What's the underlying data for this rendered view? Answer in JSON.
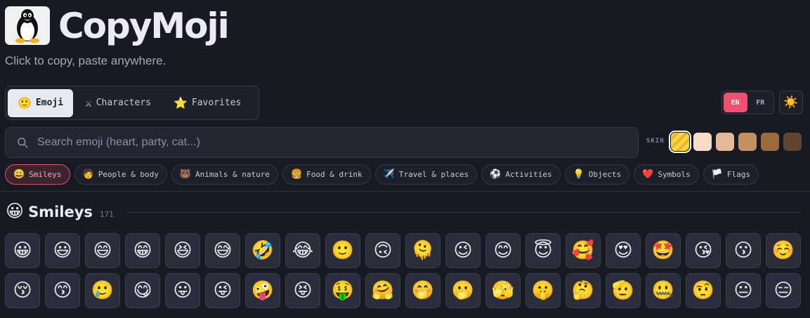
{
  "app": {
    "title": "CopyMoji",
    "tagline": "Click to copy, paste anywhere.",
    "logo_icon": "penguin-icon"
  },
  "tabs": [
    {
      "icon": "🙂",
      "label": "Emoji",
      "active": true
    },
    {
      "icon": "⚔",
      "label": "Characters",
      "active": false
    },
    {
      "icon": "⭐",
      "label": "Favorites",
      "active": false
    }
  ],
  "language": {
    "options": [
      "EN",
      "FR"
    ],
    "selected": "EN"
  },
  "theme_icon": "☀️",
  "search": {
    "placeholder": "Search emoji (heart, party, cat...)",
    "value": ""
  },
  "skin": {
    "label": "SKIN",
    "tones": [
      "default",
      "#f8dbc9",
      "#e4b999",
      "#c48e63",
      "#9b6a40",
      "#5f4632"
    ],
    "selected": "default"
  },
  "categories": [
    {
      "icon": "😀",
      "label": "Smileys",
      "active": true
    },
    {
      "icon": "🧑",
      "label": "People & body",
      "active": false
    },
    {
      "icon": "🐻",
      "label": "Animals & nature",
      "active": false
    },
    {
      "icon": "🍔",
      "label": "Food & drink",
      "active": false
    },
    {
      "icon": "✈️",
      "label": "Travel & places",
      "active": false
    },
    {
      "icon": "⚽",
      "label": "Activities",
      "active": false
    },
    {
      "icon": "💡",
      "label": "Objects",
      "active": false
    },
    {
      "icon": "❤️",
      "label": "Symbols",
      "active": false
    },
    {
      "icon": "🏳️",
      "label": "Flags",
      "active": false
    }
  ],
  "section": {
    "icon": "😀",
    "title": "Smileys",
    "count": "171"
  },
  "emojis": [
    "😀",
    "😃",
    "😄",
    "😁",
    "😆",
    "😅",
    "🤣",
    "😂",
    "🙂",
    "🙃",
    "🫠",
    "😉",
    "😊",
    "😇",
    "🥰",
    "😍",
    "🤩",
    "😘",
    "😗",
    "☺️",
    "😚",
    "😙",
    "🥲",
    "😋",
    "😛",
    "😜",
    "🤪",
    "😝",
    "🤑",
    "🤗",
    "🤭",
    "🫢",
    "🫣",
    "🤫",
    "🤔",
    "🫡",
    "🤐",
    "🤨",
    "😐",
    "😑"
  ]
}
